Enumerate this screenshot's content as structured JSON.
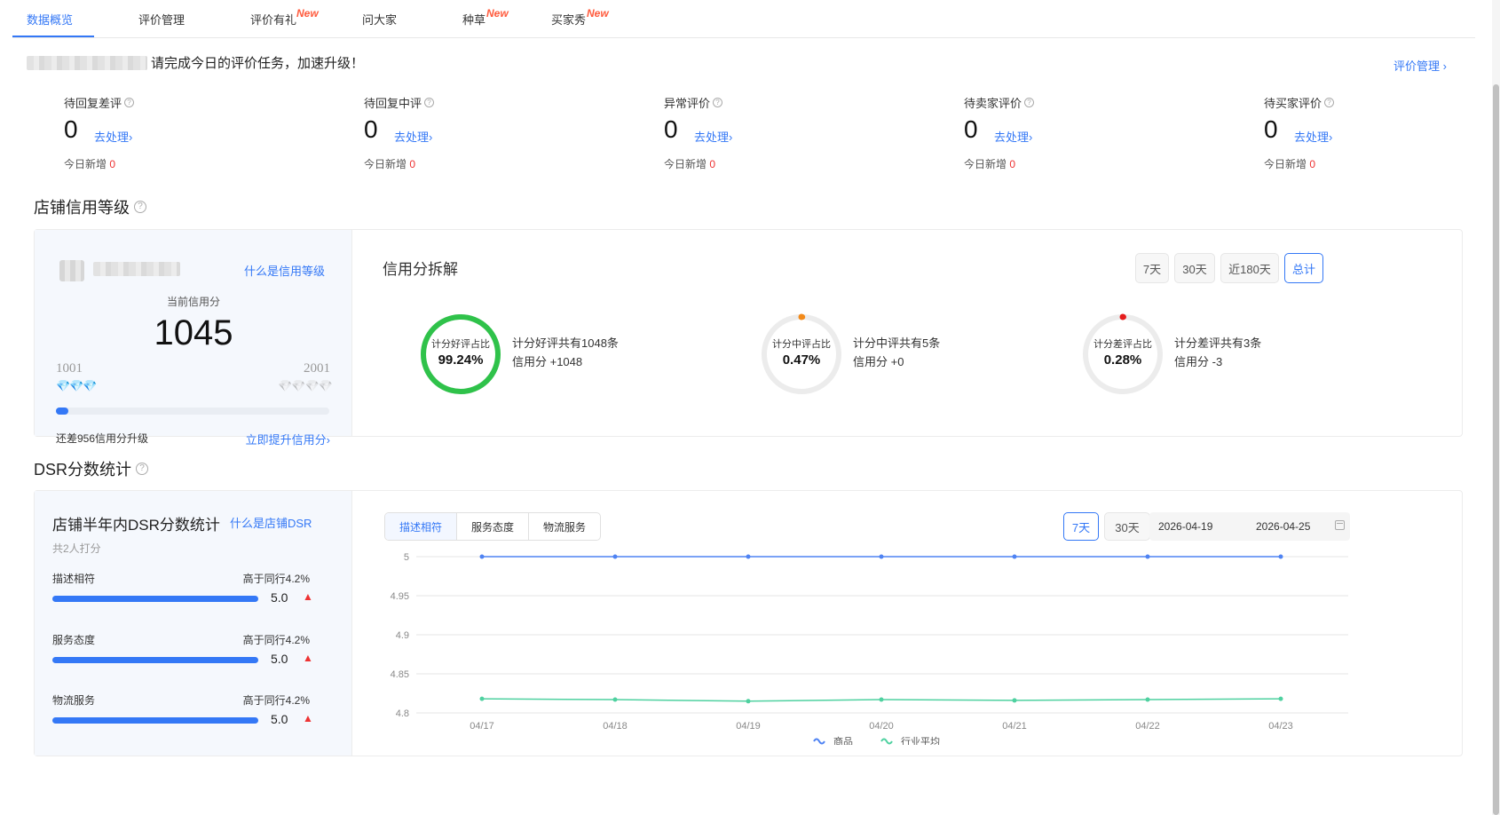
{
  "tabs": [
    {
      "label": "数据概览",
      "active": true
    },
    {
      "label": "评价管理",
      "badge": ""
    },
    {
      "label": "评价有礼",
      "badge": "New"
    },
    {
      "label": "问大家",
      "badge": ""
    },
    {
      "label": "种草",
      "badge": "New"
    },
    {
      "label": "买家秀",
      "badge": "New"
    }
  ],
  "notice": {
    "text": "请完成今日的评价任务，加速升级！",
    "manage_link": "评价管理 ›"
  },
  "stats": [
    {
      "title": "待回复差评",
      "value": "0",
      "link": "去处理›",
      "new_label": "今日新增",
      "new_value": "0"
    },
    {
      "title": "待回复中评",
      "value": "0",
      "link": "去处理›",
      "new_label": "今日新增",
      "new_value": "0"
    },
    {
      "title": "异常评价",
      "value": "0",
      "link": "去处理›",
      "new_label": "今日新增",
      "new_value": "0"
    },
    {
      "title": "待卖家评价",
      "value": "0",
      "link": "去处理›",
      "new_label": "今日新增",
      "new_value": "0"
    },
    {
      "title": "待买家评价",
      "value": "0",
      "link": "去处理›",
      "new_label": "今日新增",
      "new_value": "0"
    }
  ],
  "credit": {
    "section_title": "店铺信用等级",
    "what_link": "什么是信用等级",
    "current_label": "当前信用分",
    "score": "1045",
    "level_min": "1001",
    "level_max": "2001",
    "progress_fraction": 0.044,
    "remain_text": "还差956信用分升级",
    "improve_link": "立即提升信用分›"
  },
  "decomp": {
    "title": "信用分拆解",
    "ranges": [
      "7天",
      "30天",
      "近180天",
      "总计"
    ],
    "active_range": "总计",
    "items": [
      {
        "label": "计分好评占比",
        "value": "99.24%",
        "fraction": 0.9924,
        "line1": "计分好评共有1048条",
        "line2": "信用分 +1048",
        "color": "#2fc24a"
      },
      {
        "label": "计分中评占比",
        "value": "0.47%",
        "fraction": 0.0047,
        "line1": "计分中评共有5条",
        "line2": "信用分 +0",
        "color": "#f28a1a"
      },
      {
        "label": "计分差评占比",
        "value": "0.28%",
        "fraction": 0.0028,
        "line1": "计分差评共有3条",
        "line2": "信用分 -3",
        "color": "#e51c1c"
      }
    ]
  },
  "dsr": {
    "section_title": "DSR分数统计",
    "card_title": "店铺半年内DSR分数统计",
    "what_link": "什么是店铺DSR",
    "count_text": "共2人打分",
    "rows": [
      {
        "name": "描述相符",
        "compare": "高于同行4.2%",
        "score": "5.0",
        "arrow": "▲"
      },
      {
        "name": "服务态度",
        "compare": "高于同行4.2%",
        "score": "5.0",
        "arrow": "▲"
      },
      {
        "name": "物流服务",
        "compare": "高于同行4.2%",
        "score": "5.0",
        "arrow": "▲"
      }
    ],
    "tabs": [
      "描述相符",
      "服务态度",
      "物流服务"
    ],
    "active_tab": "描述相符",
    "ranges": [
      "7天",
      "30天"
    ],
    "active_range": "7天",
    "date_start": "2026-04-19",
    "date_end": "2026-04-25"
  },
  "chart_data": {
    "type": "line",
    "x": [
      "04/17",
      "04/18",
      "04/19",
      "04/20",
      "04/21",
      "04/22",
      "04/23"
    ],
    "ylim": [
      4.8,
      5
    ],
    "yticks": [
      "5",
      "4.95",
      "4.9",
      "4.85",
      "4.8"
    ],
    "grid": true,
    "legend_position": "bottom",
    "series": [
      {
        "name": "商品",
        "values": [
          5,
          5,
          5,
          5,
          5,
          5,
          5
        ],
        "color": "#4f83f3"
      },
      {
        "name": "行业平均",
        "values": [
          4.818,
          4.817,
          4.815,
          4.817,
          4.816,
          4.817,
          4.818
        ],
        "color": "#4fd1a0"
      }
    ]
  }
}
